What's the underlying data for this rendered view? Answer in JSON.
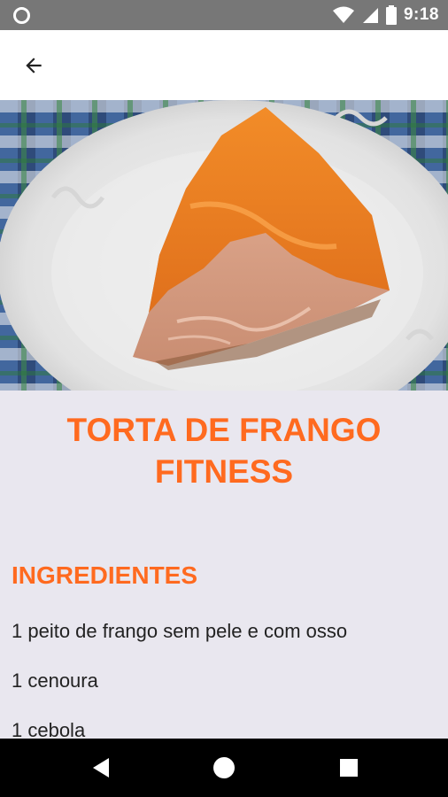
{
  "status_bar": {
    "time": "9:18",
    "icons": [
      "notification-circle-icon",
      "wifi-icon",
      "signal-icon",
      "battery-icon"
    ]
  },
  "app_bar": {
    "back_icon": "arrow-back-icon"
  },
  "recipe": {
    "title_line1": "TORTA DE FRANGO",
    "title_line2": "FITNESS",
    "ingredients_heading": "INGREDIENTES",
    "ingredients": [
      "1 peito de frango sem pele e com osso",
      "1 cenoura",
      "1 cebola"
    ]
  },
  "nav_bar": {
    "icons": [
      "back-triangle-icon",
      "home-circle-icon",
      "recents-square-icon"
    ]
  },
  "colors": {
    "accent": "#ff6a1f",
    "status_bar": "#777777",
    "background": "#e9e7ef"
  }
}
